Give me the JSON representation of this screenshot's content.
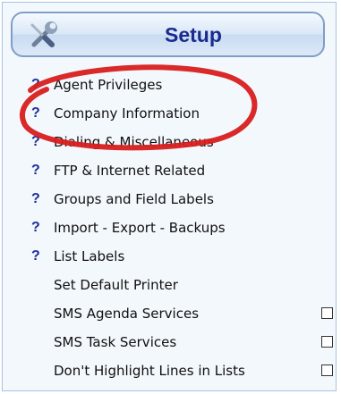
{
  "header": {
    "title": "Setup",
    "icon": "tools-icon"
  },
  "items": [
    {
      "label": "Agent Privileges",
      "help": "?"
    },
    {
      "label": "Company Information",
      "help": "?"
    },
    {
      "label": "Dialing & Miscellaneous",
      "help": "?"
    },
    {
      "label": "FTP & Internet Related",
      "help": "?"
    },
    {
      "label": "Groups and Field Labels",
      "help": "?"
    },
    {
      "label": "Import - Export - Backups",
      "help": "?"
    },
    {
      "label": "List Labels",
      "help": "?"
    },
    {
      "label": "Set Default Printer"
    },
    {
      "label": "SMS Agenda Services",
      "checked": false
    },
    {
      "label": "SMS Task Services",
      "checked": false
    },
    {
      "label": "Don't Highlight Lines in Lists",
      "checked": false
    }
  ],
  "annotation": {
    "color": "#d81e1e"
  },
  "colors": {
    "title": "#1a2a8f",
    "help_icon": "#1f2e9b",
    "panel_border": "#a9c3e2"
  }
}
